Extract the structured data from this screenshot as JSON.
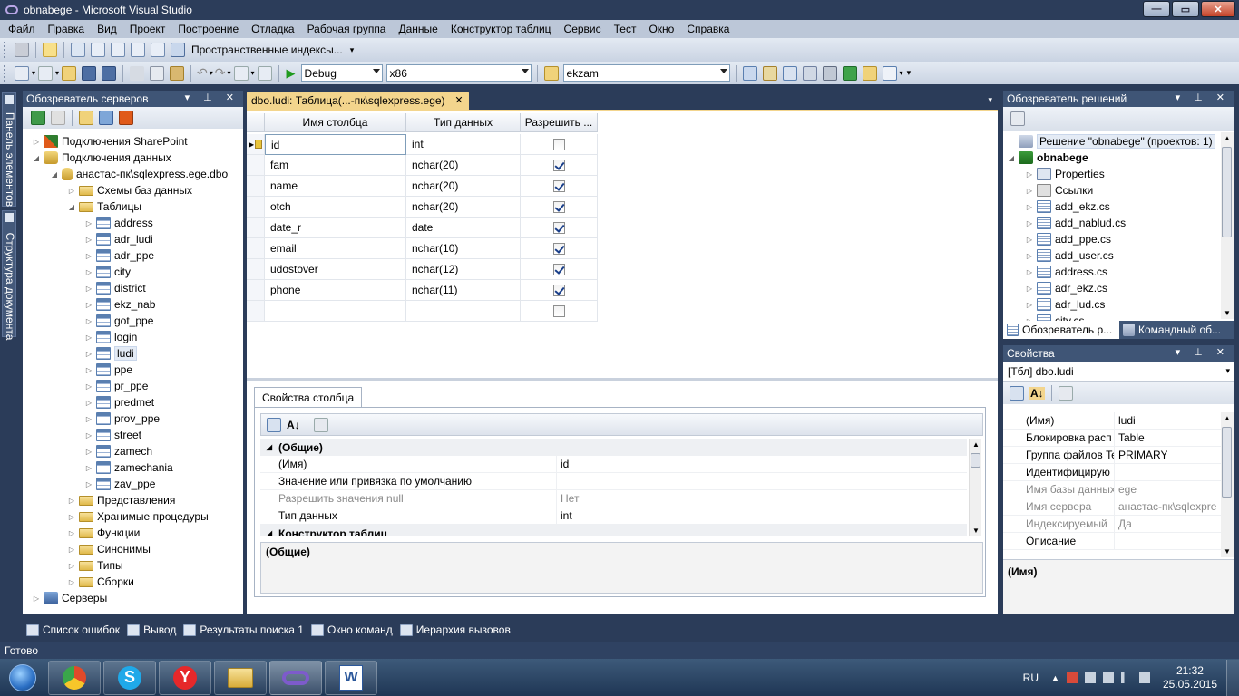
{
  "window": {
    "title": "obnabege - Microsoft Visual Studio",
    "min": "—",
    "max": "▭",
    "close": "✕"
  },
  "menu": [
    "Файл",
    "Правка",
    "Вид",
    "Проект",
    "Построение",
    "Отладка",
    "Рабочая группа",
    "Данные",
    "Конструктор таблиц",
    "Сервис",
    "Тест",
    "Окно",
    "Справка"
  ],
  "toolbar1": {
    "spatial_indexes": "Пространственные индексы..."
  },
  "toolbar2": {
    "config": "Debug",
    "platform": "x86",
    "find": "ekzam"
  },
  "left_vtabs": [
    "Панель элементов",
    "Структура документа"
  ],
  "server_explorer": {
    "title": "Обозреватель серверов",
    "sharepoint": "Подключения SharePoint",
    "data_connections": "Подключения данных",
    "connection": "анастас-пк\\sqlexpress.ege.dbo",
    "schemas": "Схемы баз данных",
    "tables_label": "Таблицы",
    "tables": [
      "address",
      "adr_ludi",
      "adr_ppe",
      "city",
      "district",
      "ekz_nab",
      "got_ppe",
      "login",
      "ludi",
      "ppe",
      "pr_ppe",
      "predmet",
      "prov_ppe",
      "street",
      "zamech",
      "zamechania",
      "zav_ppe"
    ],
    "after": [
      "Представления",
      "Хранимые процедуры",
      "Функции",
      "Синонимы",
      "Типы",
      "Сборки"
    ],
    "servers": "Серверы"
  },
  "doc_tab": {
    "label": "dbo.ludi: Таблица(...-пк\\sqlexpress.ege)",
    "close": "✕"
  },
  "designer": {
    "headers": [
      "Имя столбца",
      "Тип данных",
      "Разрешить ..."
    ],
    "rows": [
      {
        "name": "id",
        "type": "int",
        "nulls": false,
        "key": true
      },
      {
        "name": "fam",
        "type": "nchar(20)",
        "nulls": true
      },
      {
        "name": "name",
        "type": "nchar(20)",
        "nulls": true
      },
      {
        "name": "otch",
        "type": "nchar(20)",
        "nulls": true
      },
      {
        "name": "date_r",
        "type": "date",
        "nulls": true
      },
      {
        "name": "email",
        "type": "nchar(10)",
        "nulls": true
      },
      {
        "name": "udostover",
        "type": "nchar(12)",
        "nulls": true
      },
      {
        "name": "phone",
        "type": "nchar(11)",
        "nulls": true
      },
      {
        "name": "",
        "type": "",
        "nulls": false
      }
    ]
  },
  "column_props": {
    "tab": "Свойства столбца",
    "group1": "(Общие)",
    "rows": [
      {
        "k": "(Имя)",
        "v": "id",
        "gray": false
      },
      {
        "k": "Значение или привязка по умолчанию",
        "v": "",
        "gray": false
      },
      {
        "k": "Разрешить значения null",
        "v": "Нет",
        "gray": true
      },
      {
        "k": "Тип данных",
        "v": "int",
        "gray": false
      }
    ],
    "group2": "Конструктор таблиц",
    "desc_title": "(Общие)"
  },
  "solution_explorer": {
    "title": "Обозреватель решений",
    "solution": "Решение \"obnabege\"  (проектов: 1)",
    "project": "obnabege",
    "items": [
      "Properties",
      "Ссылки",
      "add_ekz.cs",
      "add_nablud.cs",
      "add_ppe.cs",
      "add_user.cs",
      "address.cs",
      "adr_ekz.cs",
      "adr_lud.cs",
      "city.cs"
    ],
    "tab1": "Обозреватель р...",
    "tab2": "Командный об..."
  },
  "properties": {
    "title": "Свойства",
    "object": "[Тбл] dbo.ludi",
    "rows": [
      {
        "k": "(Имя)",
        "v": "ludi",
        "gray": false
      },
      {
        "k": "Блокировка расп",
        "v": "Table",
        "gray": false
      },
      {
        "k": "Группа файлов Te",
        "v": "PRIMARY",
        "gray": false
      },
      {
        "k": "Идентифицирую",
        "v": "",
        "gray": false
      },
      {
        "k": "Имя базы данных",
        "v": "ege",
        "gray": true
      },
      {
        "k": "Имя сервера",
        "v": "анастас-пк\\sqlexpre",
        "gray": true
      },
      {
        "k": "Индексируемый",
        "v": "Да",
        "gray": true
      },
      {
        "k": "Описание",
        "v": "",
        "gray": false
      }
    ],
    "desc": "(Имя)"
  },
  "bottom_tabs": [
    "Список ошибок",
    "Вывод",
    "Результаты поиска 1",
    "Окно команд",
    "Иерархия вызовов"
  ],
  "status": "Готово",
  "tray": {
    "lang": "RU",
    "time": "21:32",
    "date": "25.05.2015"
  },
  "colors": {
    "accent": "#f3d58d",
    "panel_header": "#3f5576",
    "frame": "#2b3c59"
  }
}
